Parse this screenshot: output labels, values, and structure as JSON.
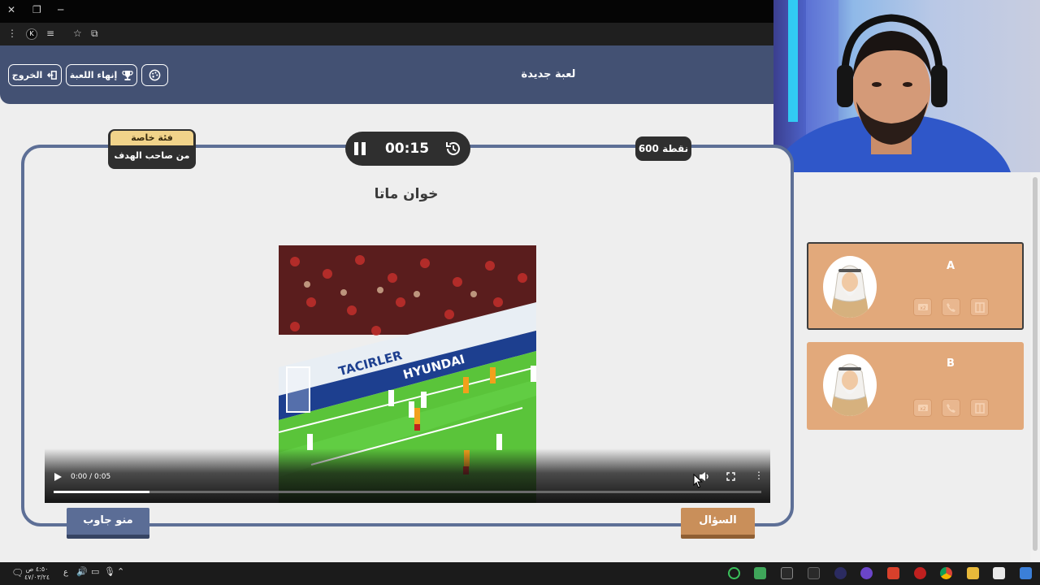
{
  "header": {
    "title": "لعبة جديدة",
    "exit_label": "الخروج",
    "end_game_label": "إنهاء اللعبة"
  },
  "question": {
    "category_label": "فئة خاصة",
    "category_name": "من صاحب الهدف",
    "timer": "00:15",
    "points": "600 نقطة",
    "text": "خوان ماتا"
  },
  "video": {
    "time": "0:00 / 0:05",
    "progress": 0.135,
    "banner_text": "TACIRLER",
    "sponsor_text": "HYUNDAI"
  },
  "buttons": {
    "who_answered": "منو جاوب",
    "question": "السؤال"
  },
  "teams": [
    {
      "name": "A"
    },
    {
      "name": "B"
    }
  ],
  "taskbar": {
    "time": "٤:٥٠ ص",
    "date": "٤٧/٠٣/٢٤",
    "lang": "ع"
  },
  "colors": {
    "header": "#435173",
    "team_card": "#e2a97b",
    "category_tag": "#f1d38a",
    "question_button": "#c98f5a",
    "who_answered_button": "#5b6d96"
  }
}
